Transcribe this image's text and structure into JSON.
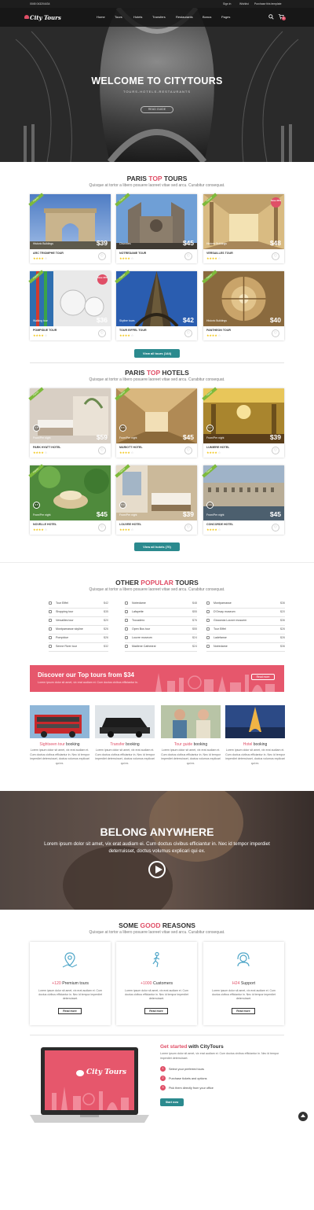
{
  "topbar": {
    "phone": "0045 043204434",
    "signin": "Sign in",
    "wishlist": "Wishlist",
    "purchase": "Purchase this template"
  },
  "header": {
    "logo": "City Tours",
    "nav": [
      "Home",
      "Tours",
      "Hotels",
      "Transfers",
      "Restaurants",
      "Bonus",
      "Pages"
    ],
    "cart_count": "0"
  },
  "hero": {
    "title": "WELCOME TO CITYTOURS",
    "subtitle": "TOURS-HOTELS-RESTAURANTS",
    "button": "READ GUIDE"
  },
  "tours_section": {
    "title_pre": "PARIS ",
    "title_hl": "TOP",
    "title_post": " TOURS",
    "subtitle": "Quisque at tortor a libero posuere laoreet vitae sed arcu. Curabitur consequat.",
    "ribbon": "Popular",
    "items": [
      {
        "name": "ARC TRIOMPHE TOUR",
        "category": "Historic Buildings",
        "price": "$39",
        "rating": 4
      },
      {
        "name": "NOTREDAME TOUR",
        "category": "Churches",
        "price": "$45",
        "rating": 4
      },
      {
        "name": "VERSAILLES TOUR",
        "category": "Historic Buildings",
        "price": "$48",
        "rating": 4,
        "promo": "Save 30%"
      },
      {
        "name": "POMPIDUE TOUR",
        "category": "Walking tour",
        "price": "$36",
        "rating": 4,
        "promo": "Save 20%"
      },
      {
        "name": "TOUR EIFFEL TOUR",
        "category": "Skyline tours",
        "price": "$42",
        "rating": 4
      },
      {
        "name": "PANTHEON TOUR",
        "category": "Historic Buildings",
        "price": "$40",
        "rating": 4
      }
    ],
    "view_all": "View all tours (144)"
  },
  "hotels_section": {
    "title_pre": "PARIS ",
    "title_hl": "TOP",
    "title_post": " HOTELS",
    "subtitle": "Quisque at tortor a libero posuere laoreet vitae sed arcu. Curabitur consequat.",
    "per_night": "From/Per night",
    "items": [
      {
        "name": "PARK HYATT HOTEL",
        "score": "7.5",
        "price": "$59",
        "rating": 4
      },
      {
        "name": "MARIOTT HOTEL",
        "score": "8.5",
        "price": "$45",
        "rating": 4
      },
      {
        "name": "LUMIERE HOTEL",
        "score": "9.0",
        "price": "$39",
        "rating": 4
      },
      {
        "name": "NOVELLE HOTEL",
        "score": "9.5",
        "price": "$45",
        "rating": 4
      },
      {
        "name": "LOUVRE HOTEL",
        "score": "8.0",
        "price": "$39",
        "rating": 4
      },
      {
        "name": "CONCORDE HOTEL",
        "score": "7.5",
        "price": "$45",
        "rating": 4
      }
    ],
    "view_all": "View all hotels (70)"
  },
  "popular_section": {
    "title_pre": "OTHER ",
    "title_hl": "POPULAR",
    "title_post": " TOURS",
    "subtitle": "Quisque at tortor a libero posuere laoreet vitae sed arcu. Curabitur consequat.",
    "columns": [
      [
        {
          "label": "Tour Eiffel",
          "price": "$42"
        },
        {
          "label": "Shopping tour",
          "price": "$35"
        },
        {
          "label": "Versailles tour",
          "price": "$20"
        },
        {
          "label": "Montparnasse skyline",
          "price": "$26"
        },
        {
          "label": "Pompidue",
          "price": "$26"
        },
        {
          "label": "Senne River tour",
          "price": "$32"
        }
      ],
      [
        {
          "label": "Notredame",
          "price": "$48"
        },
        {
          "label": "Lafayette",
          "price": "$55"
        },
        {
          "label": "Trocadero",
          "price": "$76"
        },
        {
          "label": "Open Bus tour",
          "price": "$55"
        },
        {
          "label": "Louvre museum",
          "price": "$24"
        },
        {
          "label": "Madlene Cathedral",
          "price": "$24"
        }
      ],
      [
        {
          "label": "Montparnasse",
          "price": "$36"
        },
        {
          "label": "D'Orsay museum",
          "price": "$20"
        },
        {
          "label": "Gioconda Louvre musuem",
          "price": "$36"
        },
        {
          "label": "Tour Eiffel",
          "price": "$26"
        },
        {
          "label": "Ladefanse",
          "price": "$26"
        },
        {
          "label": "Notredame",
          "price": "$36"
        }
      ]
    ]
  },
  "banner": {
    "text": "Discover our Top tours from $34",
    "sub": "Lorem ipsum dolor sit amet, vix erat audiam ei. Cum doctus civibus efficiantur in.",
    "button": "Read more"
  },
  "services": [
    {
      "hl": "Sightseen tour",
      "rest": " booking",
      "desc": "Lorem ipsum dolor sit amet, vix erat audiam ei. Cum doctus civibus efficiantur in. Nec id tempor imperdiet deterruisset, doctus volumus explicari qui ex."
    },
    {
      "hl": "Transfer",
      "rest": " booking",
      "desc": "Lorem ipsum dolor sit amet, vix erat audiam ei. Cum doctus civibus efficiantur in. Nec id tempor imperdiet deterruisset, doctus volumus explicari qui ex."
    },
    {
      "hl": "Tour guide",
      "rest": " booking",
      "desc": "Lorem ipsum dolor sit amet, vix erat audiam ei. Cum doctus civibus efficiantur in. Nec id tempor imperdiet deterruisset, doctus volumus explicari qui ex."
    },
    {
      "hl": "Hotel",
      "rest": " booking",
      "desc": "Lorem ipsum dolor sit amet, vix erat audiam ei. Cum doctus civibus efficiantur in. Nec id tempor imperdiet deterruisset, doctus volumus explicari qui ex."
    }
  ],
  "belong": {
    "title": "BELONG ANYWHERE",
    "subtitle": "Lorem ipsum dolor sit amet, vix erat audiam ei. Cum doctus civibus efficiantur in. Nec id tempor imperdiet deterruisset, doctus volumus explicari qui ex."
  },
  "reasons_section": {
    "title_pre": "SOME ",
    "title_hl": "GOOD",
    "title_post": " REASONS",
    "subtitle": "Quisque at tortor a libero posuere laoreet vitae sed arcu. Curabitur consequat.",
    "items": [
      {
        "hl": "+120",
        "rest": " Premium tours",
        "icon": "map-pin-icon",
        "desc": "Lorem ipsum dolor sit amet, vix erat audiam ei. Cum doctus civibus efficiantur in. Nec id tempor imperdiet deterruisset.",
        "button": "Read more"
      },
      {
        "hl": "+1000",
        "rest": " Customers",
        "icon": "walking-person-icon",
        "desc": "Lorem ipsum dolor sit amet, vix erat audiam ei. Cum doctus civibus efficiantur in. Nec id tempor imperdiet deterruisset.",
        "button": "Read more"
      },
      {
        "hl": "H24",
        "rest": " Support",
        "icon": "headset-icon",
        "desc": "Lorem ipsum dolor sit amet, vix erat audiam ei. Cum doctus civibus efficiantur in. Nec id tempor imperdiet deterruisset.",
        "button": "Read more"
      }
    ]
  },
  "getstarted": {
    "title_hl": "Get started",
    "title_post": " with CityTours",
    "desc": "Lorem ipsum dolor sit amet, vix erat audiam ei. Cum doctus civibus efficiantur in. Nec id tempor imperdiet deterruisset.",
    "steps": [
      "Select your preferred tours",
      "Purchase tickets and options",
      "Pick them directly from your office"
    ],
    "button": "Start now",
    "laptop_logo": "City Tours"
  },
  "colors": {
    "accent": "#e04f67",
    "teal": "#2b8a8e",
    "ribbon": "#7dba3b"
  }
}
